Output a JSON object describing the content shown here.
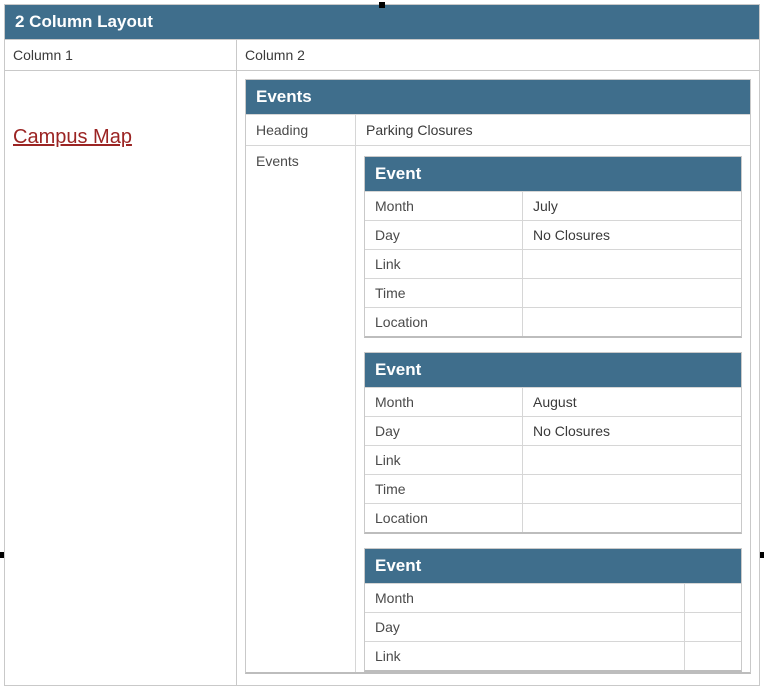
{
  "layout": {
    "title": "2 Column Layout",
    "col1": "Column 1",
    "col2": "Column 2"
  },
  "sidebar": {
    "link": "Campus Map"
  },
  "events_panel": {
    "title": "Events",
    "heading_label": "Heading",
    "heading_value": "Parking Closures",
    "events_label": "Events"
  },
  "event_labels": {
    "title": "Event",
    "month": "Month",
    "day": "Day",
    "link": "Link",
    "time": "Time",
    "location": "Location"
  },
  "events": [
    {
      "month": "July",
      "day": "No Closures",
      "link": "",
      "time": "",
      "location": ""
    },
    {
      "month": "August",
      "day": "No Closures",
      "link": "",
      "time": "",
      "location": ""
    },
    {
      "month": "",
      "day": "",
      "link": "",
      "time": "",
      "location": ""
    }
  ]
}
